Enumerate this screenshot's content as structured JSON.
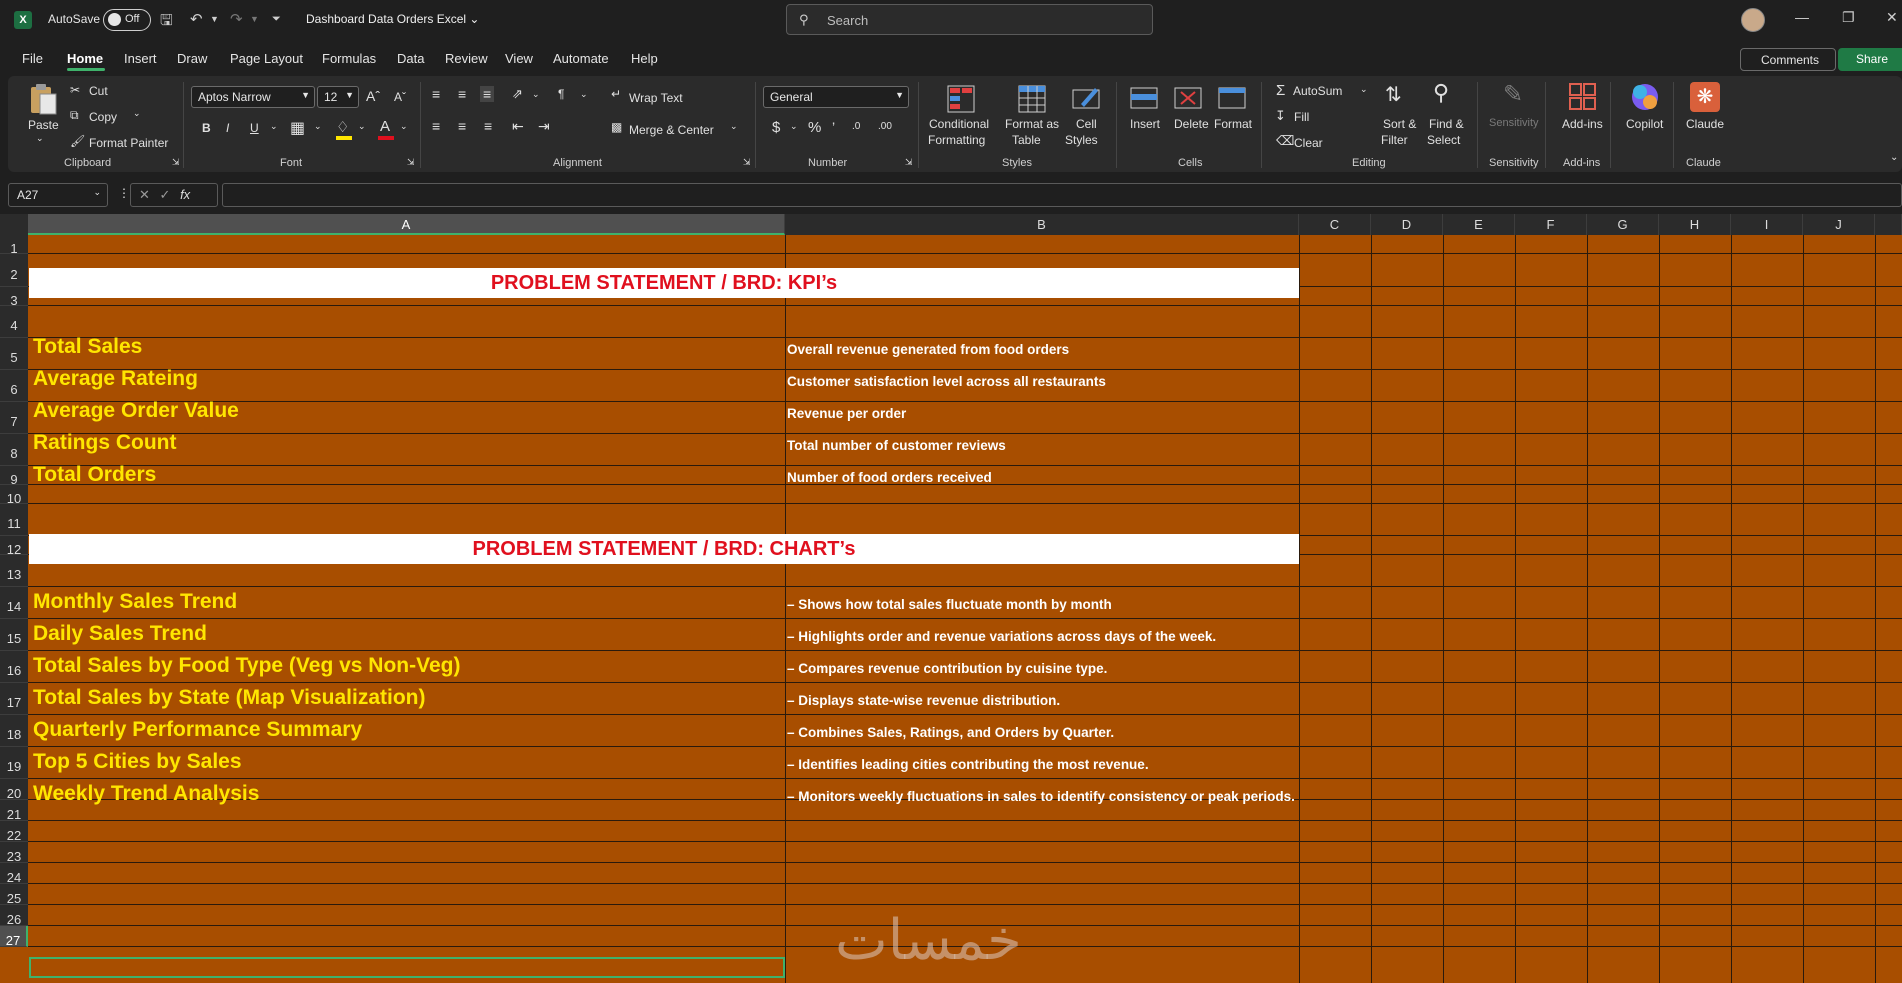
{
  "app": {
    "autosave_label": "AutoSave",
    "autosave_state": "Off",
    "doc_title": "Dashboard Data Orders Excel",
    "search_placeholder": "Search"
  },
  "menu": [
    "File",
    "Home",
    "Insert",
    "Draw",
    "Page Layout",
    "Formulas",
    "Data",
    "Review",
    "View",
    "Automate",
    "Help"
  ],
  "menu_active": "Home",
  "header_buttons": {
    "comments": "Comments",
    "share": "Share"
  },
  "ribbon": {
    "clipboard": {
      "paste": "Paste",
      "cut": "Cut",
      "copy": "Copy",
      "format_painter": "Format Painter",
      "label": "Clipboard"
    },
    "font": {
      "name": "Aptos Narrow",
      "size": "12",
      "label": "Font"
    },
    "alignment": {
      "wrap_text": "Wrap Text",
      "merge_center": "Merge & Center",
      "label": "Alignment"
    },
    "number": {
      "format": "General",
      "label": "Number"
    },
    "styles": {
      "conditional": "Conditional",
      "conditional2": "Formatting",
      "format_as": "Format as",
      "format_as2": "Table",
      "cell": "Cell",
      "cell2": "Styles",
      "label": "Styles"
    },
    "cells": {
      "insert": "Insert",
      "delete": "Delete",
      "format": "Format",
      "label": "Cells"
    },
    "editing": {
      "autosum": "AutoSum",
      "fill": "Fill",
      "clear": "Clear",
      "sort": "Sort &",
      "sort2": "Filter",
      "find": "Find &",
      "find2": "Select",
      "label": "Editing"
    },
    "sensitivity": {
      "btn": "Sensitivity",
      "label": "Sensitivity"
    },
    "addins": {
      "btn": "Add-ins",
      "label": "Add-ins"
    },
    "copilot": {
      "btn": "Copilot"
    },
    "claude": {
      "btn": "Claude",
      "label": "Claude"
    }
  },
  "formula_bar": {
    "name_box": "A27",
    "fx": "fx",
    "value": ""
  },
  "columns": [
    "A",
    "B",
    "C",
    "D",
    "E",
    "F",
    "G",
    "H",
    "I",
    "J"
  ],
  "rows": [
    "1",
    "2",
    "3",
    "4",
    "5",
    "6",
    "7",
    "8",
    "9",
    "10",
    "11",
    "12",
    "13",
    "14",
    "15",
    "16",
    "17",
    "18",
    "19",
    "20",
    "21",
    "22",
    "23",
    "24",
    "25",
    "26",
    "27"
  ],
  "sheet": {
    "banner_kpi": "PROBLEM STATEMENT / BRD: KPI’s",
    "banner_chart": "PROBLEM STATEMENT / BRD: CHART’s",
    "kpis": [
      {
        "name": "Total Sales",
        "desc": "Overall revenue generated from food orders"
      },
      {
        "name": "Average Rateing",
        "desc": "Customer satisfaction level across all restaurants"
      },
      {
        "name": "Average Order Value",
        "desc": "Revenue per order"
      },
      {
        "name": "Ratings Count",
        "desc": "Total number of customer reviews"
      },
      {
        "name": "Total Orders",
        "desc": "Number of food orders received"
      }
    ],
    "charts": [
      {
        "name": "Monthly Sales Trend",
        "desc": "– Shows how total sales fluctuate month by month"
      },
      {
        "name": "Daily Sales Trend",
        "desc": " – Highlights order and revenue variations across days of the week."
      },
      {
        "name": "Total Sales by Food Type (Veg vs Non-Veg)",
        "desc": "– Compares revenue contribution by cuisine type."
      },
      {
        "name": "Total Sales by State (Map Visualization)",
        "desc": " – Displays state-wise revenue distribution."
      },
      {
        "name": "Quarterly Performance Summary",
        "desc": "– Combines Sales, Ratings, and Orders by Quarter."
      },
      {
        "name": "Top 5 Cities by Sales",
        "desc": "– Identifies leading cities contributing the most revenue."
      },
      {
        "name": "Weekly Trend Analysis",
        "desc": "– Monitors weekly fluctuations in sales to identify consistency or peak periods."
      }
    ]
  },
  "watermark": "خمسات",
  "colors": {
    "sheet_fill": "#a84e00",
    "kpi_text": "#ffe600",
    "banner_text": "#e0101e",
    "accent": "#3fb26b"
  }
}
